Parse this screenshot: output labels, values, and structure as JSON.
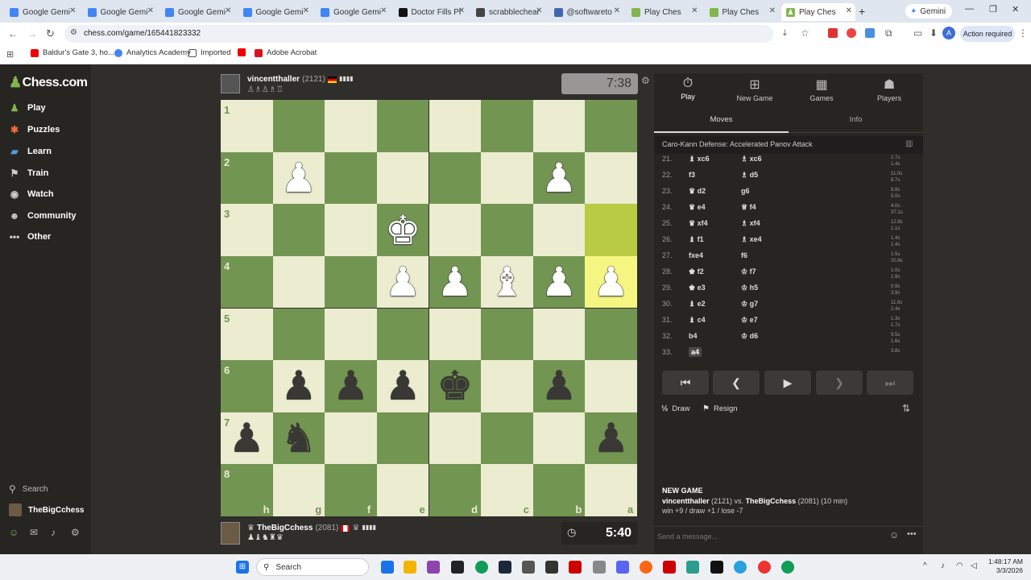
{
  "browser": {
    "tabs": [
      {
        "label": "Google Gemi",
        "color": "#4285f4"
      },
      {
        "label": "Google Gemi",
        "color": "#4285f4"
      },
      {
        "label": "Google Gemi",
        "color": "#4285f4"
      },
      {
        "label": "Google Gemi",
        "color": "#4285f4"
      },
      {
        "label": "Google Gemi",
        "color": "#4285f4"
      },
      {
        "label": "Doctor Fills Pl",
        "color": "#111111"
      },
      {
        "label": "scrabblechear",
        "color": "#444444"
      },
      {
        "label": "@softwareto",
        "color": "#4267b2"
      },
      {
        "label": "Play Ches",
        "color": "#81b64c"
      },
      {
        "label": "Play Ches",
        "color": "#81b64c"
      },
      {
        "label": "Play Ches",
        "color": "#81b64c"
      }
    ],
    "gemini_button": "Gemini",
    "url": "chess.com/game/165441823332",
    "action_required": "Action required",
    "bookmarks": [
      "Baldur's Gate 3, ho...",
      "Analytics Academy",
      "Imported",
      "Adobe Acrobat"
    ]
  },
  "sidebar": {
    "logo": "Chess.com",
    "nav": [
      "Play",
      "Puzzles",
      "Learn",
      "Train",
      "Watch",
      "Community",
      "Other"
    ],
    "search": "Search",
    "username": "TheBigCchess"
  },
  "top_player": {
    "name": "vincentthaller",
    "rating": "(2121)",
    "clock": "7:38"
  },
  "bottom_player": {
    "name": "TheBigCchess",
    "rating": "(2081)",
    "clock": "5:40"
  },
  "board": {
    "ranks": [
      "1",
      "2",
      "3",
      "4",
      "5",
      "6",
      "7",
      "8"
    ],
    "files": [
      "h",
      "g",
      "f",
      "e",
      "d",
      "c",
      "b",
      "a"
    ],
    "pieces": [
      {
        "sq": "b2",
        "glyph": "♟",
        "color": "w"
      },
      {
        "sq": "g2",
        "glyph": "♟",
        "color": "w"
      },
      {
        "sq": "e3",
        "glyph": "♚",
        "color": "w"
      },
      {
        "sq": "e4",
        "glyph": "♟",
        "color": "w"
      },
      {
        "sq": "d4",
        "glyph": "♟",
        "color": "w"
      },
      {
        "sq": "c4",
        "glyph": "♝",
        "color": "w"
      },
      {
        "sq": "b4",
        "glyph": "♟",
        "color": "w"
      },
      {
        "sq": "a4",
        "glyph": "♟",
        "color": "w"
      },
      {
        "sq": "g6",
        "glyph": "♟",
        "color": "b"
      },
      {
        "sq": "f6",
        "glyph": "♟",
        "color": "b"
      },
      {
        "sq": "e6",
        "glyph": "♟",
        "color": "b"
      },
      {
        "sq": "d6",
        "glyph": "♚",
        "color": "b"
      },
      {
        "sq": "b6",
        "glyph": "♟",
        "color": "b"
      },
      {
        "sq": "h7",
        "glyph": "♟",
        "color": "b"
      },
      {
        "sq": "g7",
        "glyph": "♞",
        "color": "b"
      },
      {
        "sq": "a7",
        "glyph": "♟",
        "color": "b"
      }
    ],
    "highlights": [
      "a3",
      "a4"
    ]
  },
  "panel": {
    "tabs": [
      "Play",
      "New Game",
      "Games",
      "Players"
    ],
    "subtabs": [
      "Moves",
      "Info"
    ],
    "opening": "Caro-Kann Defense: Accelerated Panov Attack",
    "moves": [
      {
        "n": "21.",
        "w": "♝ xc6",
        "b": "♗ xc6",
        "t1": "2.7s",
        "t2": "1.4s"
      },
      {
        "n": "22.",
        "w": "f3",
        "b": "♗ d5",
        "t1": "11.0s",
        "t2": "8.7s"
      },
      {
        "n": "23.",
        "w": "♛ d2",
        "b": "g6",
        "t1": "8.8s",
        "t2": "5.0s"
      },
      {
        "n": "24.",
        "w": "♛ e4",
        "b": "♕ f4",
        "t1": "4.0s",
        "t2": "37.1s"
      },
      {
        "n": "25.",
        "w": "♛ xf4",
        "b": "♗ xf4",
        "t1": "12.8s",
        "t2": "1.1s"
      },
      {
        "n": "26.",
        "w": "♝ f1",
        "b": "♗ xe4",
        "t1": "1.4s",
        "t2": "1.4s"
      },
      {
        "n": "27.",
        "w": "fxe4",
        "b": "f6",
        "t1": "1.5s",
        "t2": "20.9s"
      },
      {
        "n": "28.",
        "w": "♚ f2",
        "b": "♔ f7",
        "t1": "1.0s",
        "t2": "1.9s"
      },
      {
        "n": "29.",
        "w": "♚ e3",
        "b": "♔ h5",
        "t1": "0.9s",
        "t2": "3.9s"
      },
      {
        "n": "30.",
        "w": "♝ e2",
        "b": "♔ g7",
        "t1": "11.8s",
        "t2": "2.4s"
      },
      {
        "n": "31.",
        "w": "♝ c4",
        "b": "♔ e7",
        "t1": "1.3s",
        "t2": "1.7s"
      },
      {
        "n": "32.",
        "w": "b4",
        "b": "♔ d6",
        "t1": "9.5s",
        "t2": "1.6s"
      },
      {
        "n": "33.",
        "w": "a4",
        "b": "",
        "t1": "3.8s",
        "t2": ""
      }
    ],
    "draw": "Draw",
    "resign": "Resign",
    "new_game_title": "NEW GAME",
    "new_game_line_a": "vincentthaller",
    "new_game_line_b": " (2121) vs. ",
    "new_game_line_c": "TheBigCchess",
    "new_game_line_d": " (2081) (10 min)",
    "record": "win +9 / draw +1 / lose -7",
    "message_placeholder": "Send a message..."
  },
  "taskbar": {
    "search": "Search",
    "time": "1:48:17 AM",
    "date": "3/3/2026"
  }
}
